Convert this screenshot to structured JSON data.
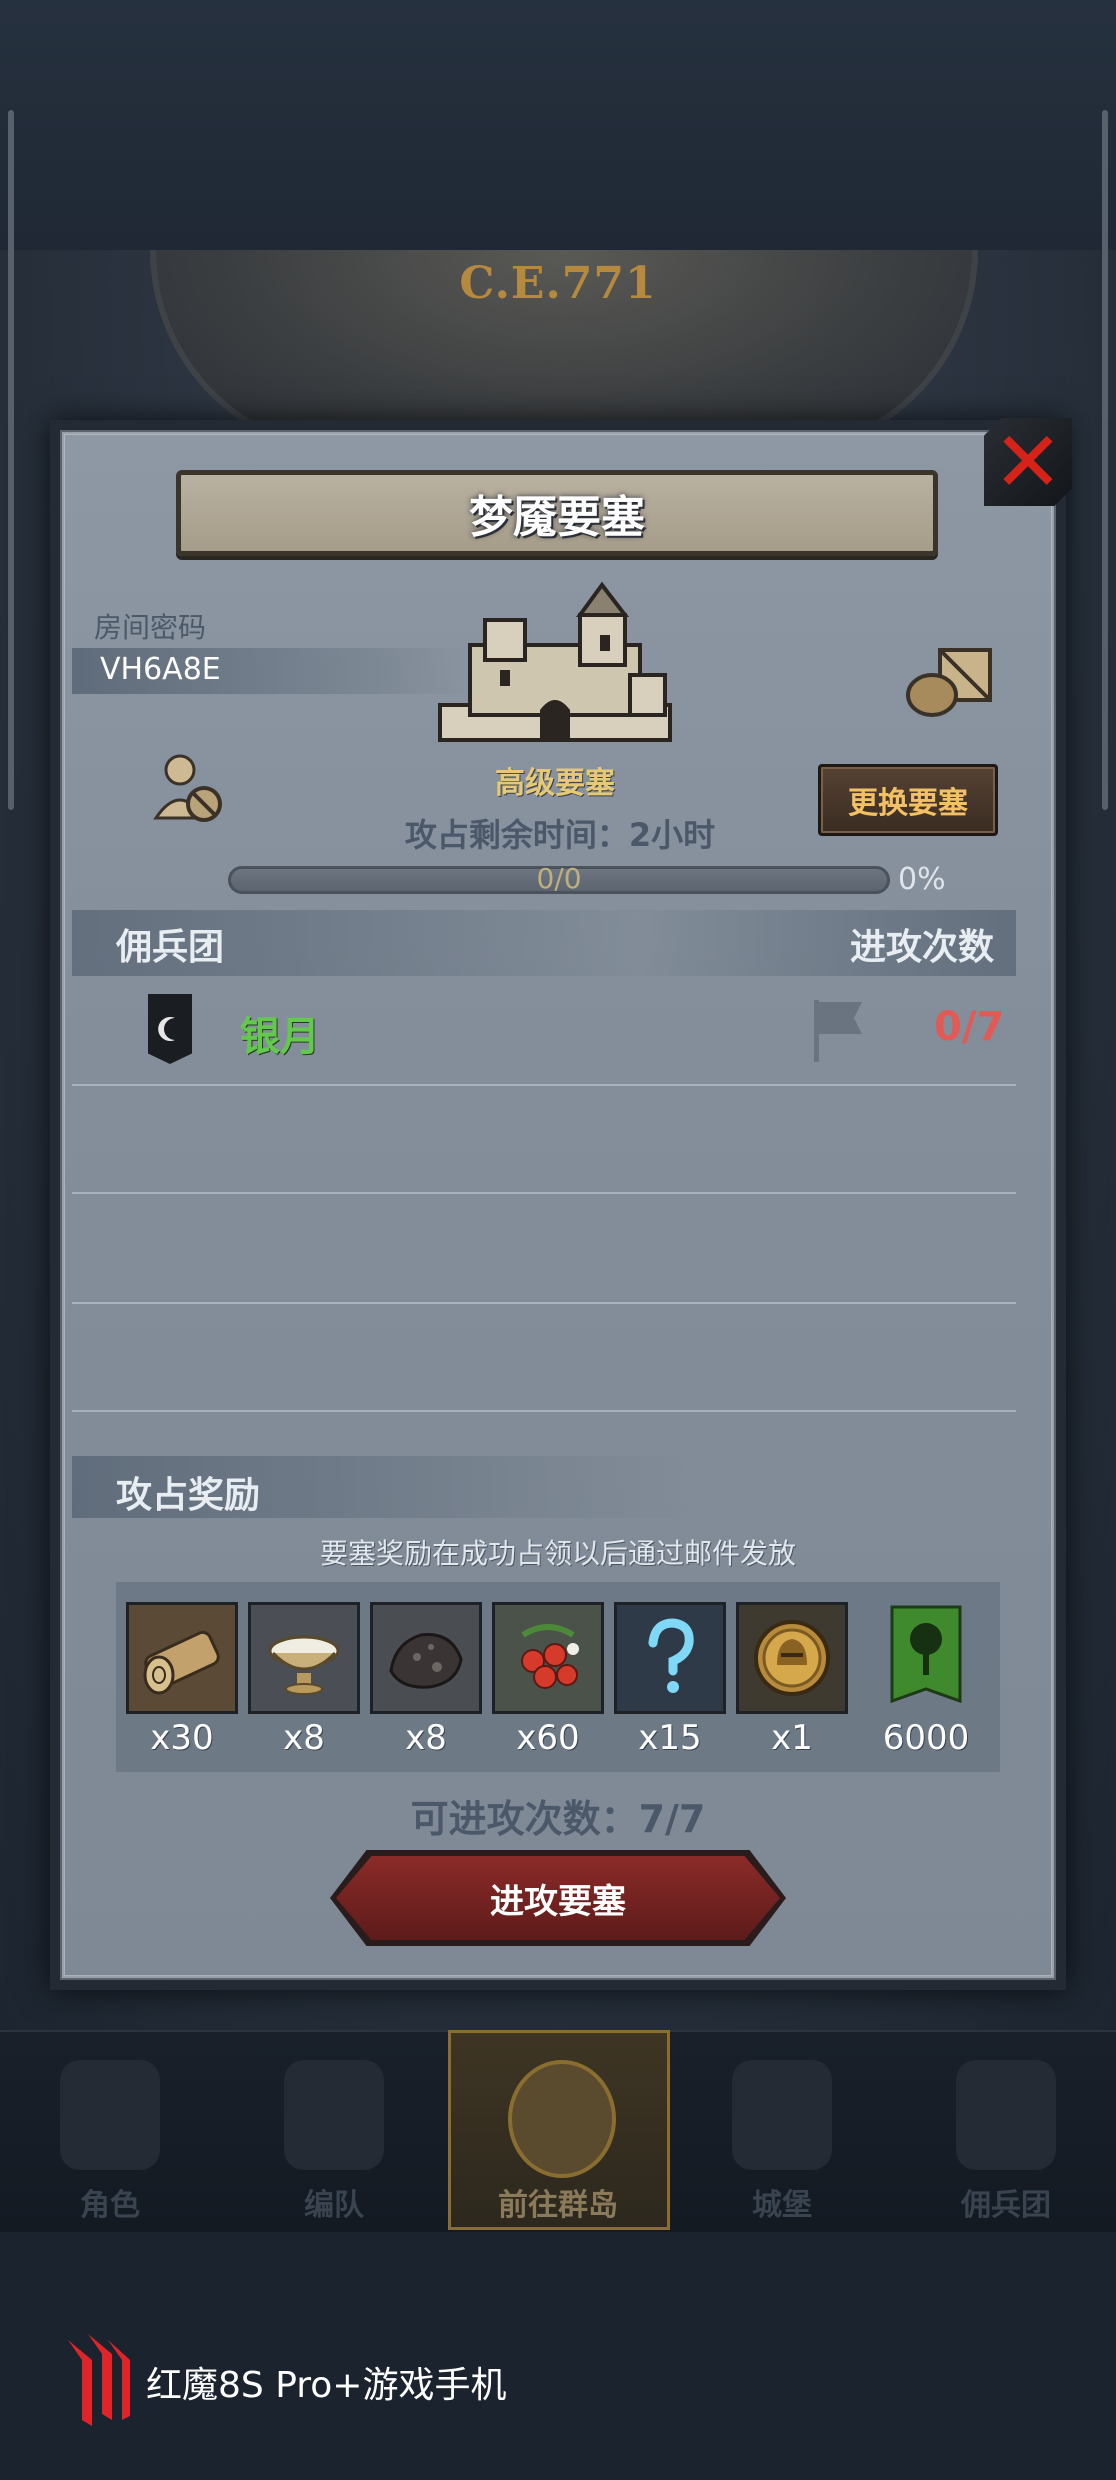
{
  "background": {
    "era": "C.E.771"
  },
  "dialog": {
    "title": "梦魇要塞",
    "room_code_label": "房间密码",
    "room_code": "VH6A8E",
    "fortress_grade": "高级要塞",
    "change_fortress_button": "更换要塞",
    "remaining_time": "攻占剩余时间：2小时",
    "progress": {
      "text": "0/0",
      "percent_label": "0%",
      "fraction": 0
    },
    "mercenary_header": "佣兵团",
    "attack_count_header": "进攻次数",
    "mercenaries": [
      {
        "name": "银月",
        "attacks": "0/7"
      }
    ],
    "reward_header": "攻占奖励",
    "reward_note": "要塞奖励在成功占领以后通过邮件发放",
    "rewards": [
      {
        "icon": "log-icon",
        "qty": "x30"
      },
      {
        "icon": "bowl-icon",
        "qty": "x8"
      },
      {
        "icon": "ore-icon",
        "qty": "x8"
      },
      {
        "icon": "berries-icon",
        "qty": "x60"
      },
      {
        "icon": "mystery-icon",
        "qty": "x15"
      },
      {
        "icon": "helmet-coin-icon",
        "qty": "x1"
      },
      {
        "icon": "tree-banner-icon",
        "qty": "6000"
      }
    ],
    "attempts": "可进攻次数：7/7",
    "attack_button": "进攻要塞"
  },
  "nav": {
    "items": [
      {
        "label": "角色"
      },
      {
        "label": "编队"
      },
      {
        "label": "前往群岛"
      },
      {
        "label": "城堡"
      },
      {
        "label": "佣兵团"
      }
    ],
    "active_index": 2
  },
  "watermark": {
    "text": "红魔8S Pro+游戏手机"
  },
  "colors": {
    "panel": "#8e98a4",
    "close_red": "#d6231a",
    "merc_green": "#62c94d",
    "count_red": "#e25a55",
    "accent_gold": "#f3c165"
  }
}
